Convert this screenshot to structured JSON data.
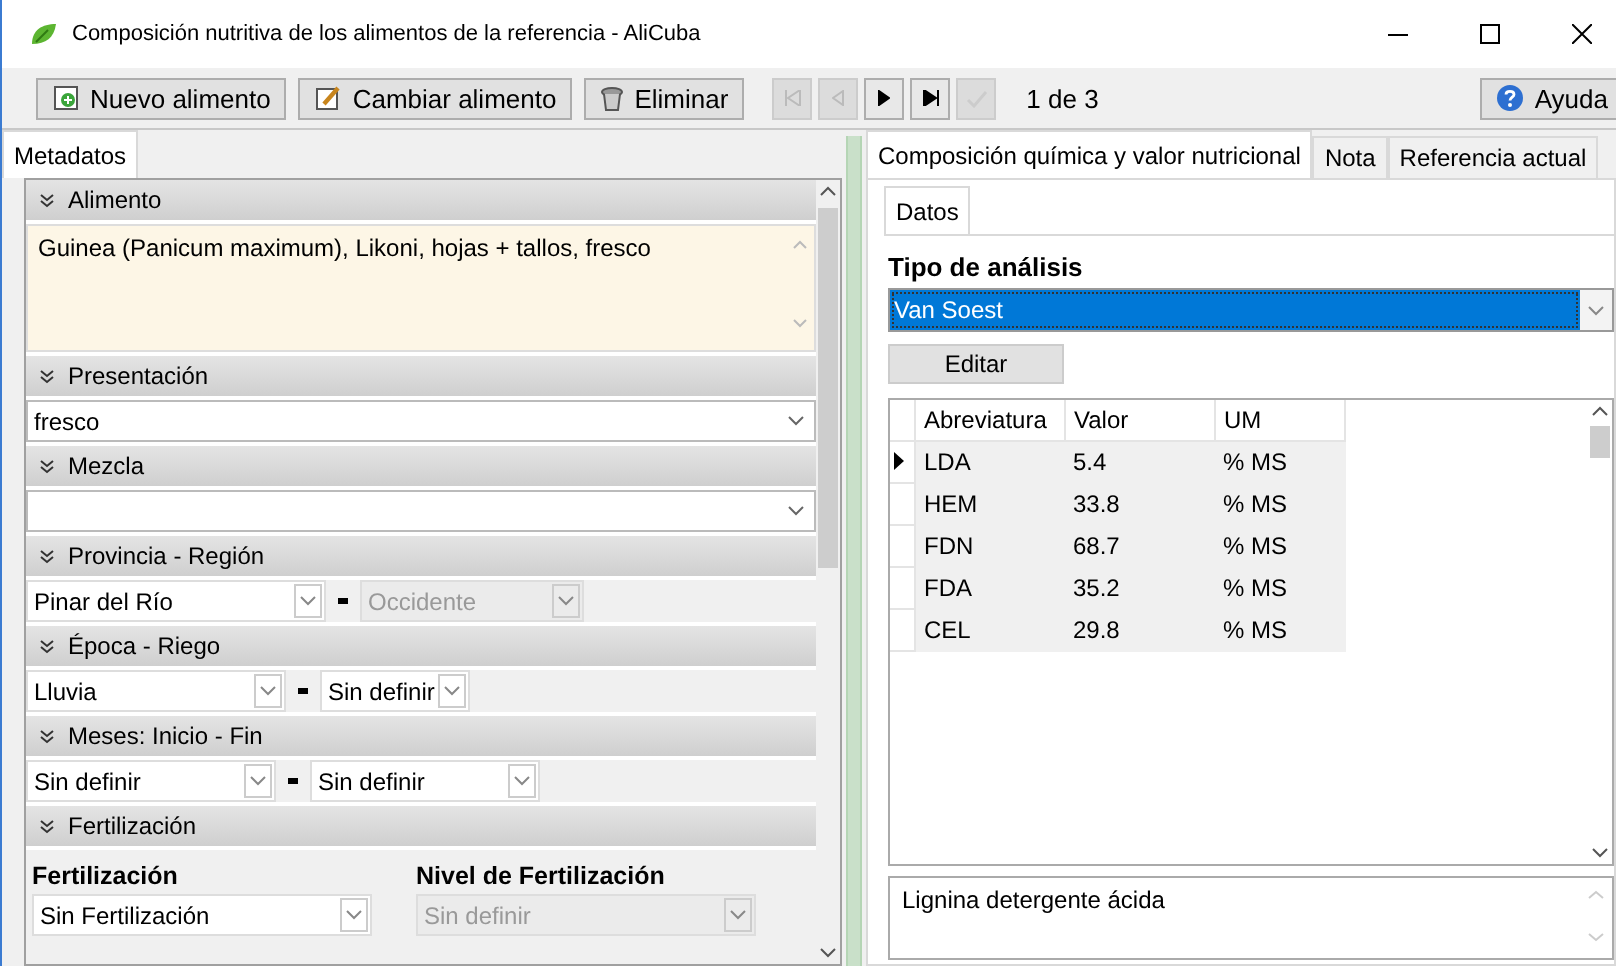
{
  "window": {
    "title": "Composición nutritiva de los alimentos de la referencia - AliCuba"
  },
  "toolbar": {
    "buttons": [
      {
        "label": "Nuevo alimento",
        "kind": "new"
      },
      {
        "label": "Cambiar alimento",
        "kind": "edit"
      },
      {
        "label": "Eliminar",
        "kind": "delete"
      }
    ],
    "nav": [
      {
        "kind": "first",
        "disabled": true
      },
      {
        "kind": "prev",
        "disabled": true
      },
      {
        "kind": "next",
        "disabled": false
      },
      {
        "kind": "last",
        "disabled": false
      },
      {
        "kind": "confirm",
        "disabled": true
      }
    ],
    "record": "1 de 3",
    "help": "Ayuda"
  },
  "left": {
    "tabs": [
      {
        "label": "Metadatos",
        "selected": true
      }
    ],
    "sections": [
      {
        "title": "Alimento",
        "kind": "memo",
        "value": "Guinea (Panicum maximum), Likoni, hojas + tallos, fresco"
      },
      {
        "title": "Presentación",
        "kind": "combo",
        "value": "fresco"
      },
      {
        "title": "Mezcla",
        "kind": "combo"
      },
      {
        "title": "Provincia - Región",
        "kind": "pair",
        "fields": [
          {
            "value": "Pinar del Río",
            "disabled": false
          },
          {
            "value": "Occidente",
            "disabled": true
          }
        ]
      },
      {
        "title": "Época - Riego",
        "kind": "pair",
        "fields": [
          {
            "value": "Lluvia",
            "disabled": false
          },
          {
            "value": "Sin definir",
            "disabled": false
          }
        ]
      },
      {
        "title": "Meses: Inicio - Fin",
        "kind": "pair",
        "fields": [
          {
            "value": "Sin definir",
            "disabled": false
          },
          {
            "value": "Sin definir",
            "disabled": false
          }
        ]
      },
      {
        "title": "Fertilización",
        "kind": "labeled",
        "fields": [
          {
            "label": "Fertilización",
            "value": "Sin Fertilización",
            "disabled": false
          },
          {
            "label": "Nivel de Fertilización",
            "value": "Sin definir",
            "disabled": true
          }
        ]
      }
    ]
  },
  "right": {
    "tabs": [
      {
        "label": "Composición química y valor nutricional",
        "selected": true
      },
      {
        "label": "Nota",
        "selected": false
      },
      {
        "label": "Referencia actual",
        "selected": false
      }
    ],
    "inner_tabs": [
      {
        "label": "Datos",
        "selected": true
      }
    ],
    "analysis": {
      "label": "Tipo de análisis",
      "value": "Van Soest"
    },
    "edit_button": "Editar",
    "table": {
      "columns": [
        "Abreviatura",
        "Valor",
        "UM"
      ],
      "rows": [
        {
          "cells": [
            "LDA",
            "5.4",
            "% MS"
          ],
          "selected": true
        },
        {
          "cells": [
            "HEM",
            "33.8",
            "% MS"
          ],
          "selected": false
        },
        {
          "cells": [
            "FDN",
            "68.7",
            "% MS"
          ],
          "selected": false
        },
        {
          "cells": [
            "FDA",
            "35.2",
            "% MS"
          ],
          "selected": false
        },
        {
          "cells": [
            "CEL",
            "29.8",
            "% MS"
          ],
          "selected": false
        }
      ]
    },
    "description": "Lignina detergente ácida"
  }
}
